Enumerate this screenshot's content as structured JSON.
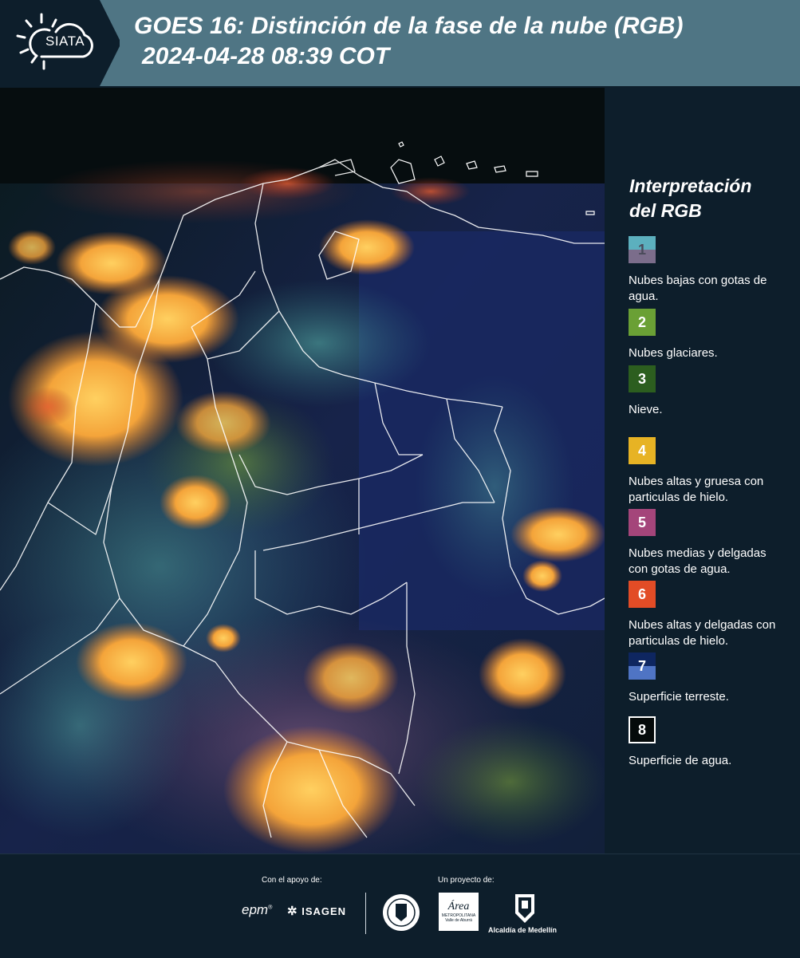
{
  "header": {
    "logo_text": "SIATA",
    "title_line1": "GOES 16: Distinción de la fase de la nube (RGB)",
    "title_line2": "2024-04-28 08:39 COT"
  },
  "legend": {
    "title_line1": "Interpretación",
    "title_line2": "del RGB",
    "items": [
      {
        "num": "1",
        "label": "Nubes bajas con gotas de agua.",
        "color_top": "#5cb0be",
        "color_bottom": "#7b6d8b"
      },
      {
        "num": "2",
        "label": "Nubes glaciares.",
        "color_top": "#6aa035",
        "color_bottom": "#6aa035"
      },
      {
        "num": "3",
        "label": "Nieve.",
        "color_top": "#2c5e1f",
        "color_bottom": "#2c5e1f"
      },
      {
        "num": "4",
        "label": "Nubes altas y gruesa con particulas de hielo.",
        "color_top": "#e7b324",
        "color_bottom": "#e7b324"
      },
      {
        "num": "5",
        "label": "Nubes medias y delgadas con gotas de agua.",
        "color_top": "#a4457a",
        "color_bottom": "#a4457a"
      },
      {
        "num": "6",
        "label": "Nubes altas y delgadas con particulas de hielo.",
        "color_top": "#e24c26",
        "color_bottom": "#e24c26"
      },
      {
        "num": "7",
        "label": "Superficie terreste.",
        "color_top": "#0e2660",
        "color_bottom": "#4f74c4"
      },
      {
        "num": "8",
        "label": "Superficie de agua.",
        "color_top": "#050a0a",
        "color_bottom": "#050a0a"
      }
    ]
  },
  "footer": {
    "support_label": "Con el apoyo de:",
    "project_label": "Un proyecto de:",
    "sponsor1": "epm",
    "sponsor2": "ISAGEN",
    "partner1": "Área",
    "partner1_sub1": "METROPOLITANA",
    "partner1_sub2": "Valle de Aburrá",
    "partner2": "Alcaldía de Medellín"
  },
  "colors": {
    "header_bg": "#4f7584",
    "panel_bg": "#0d1e2b",
    "cloud_orange": "#f4a43a",
    "cloud_cyan": "#5fc6b6"
  }
}
